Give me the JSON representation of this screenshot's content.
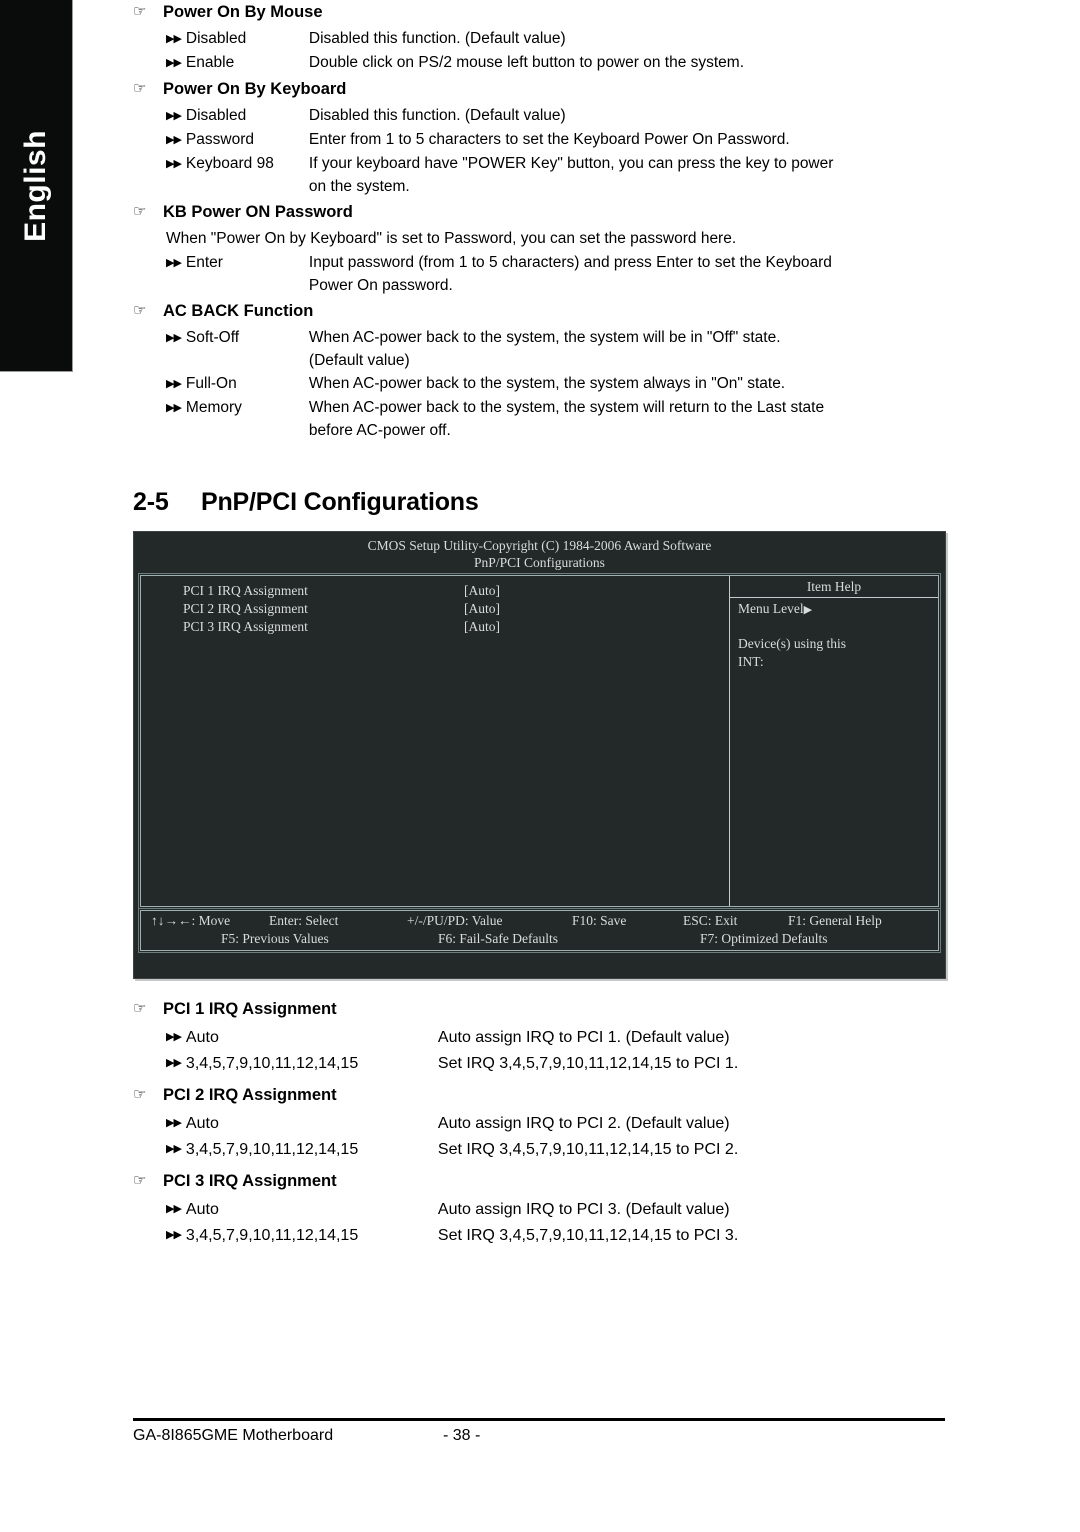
{
  "language_tab": {
    "label": "English"
  },
  "options_top": [
    {
      "icon": "hand-pointer-icon",
      "title": "Power On By Mouse",
      "rows": [
        {
          "name": "Disabled",
          "desc": "Disabled this function. (Default value)"
        },
        {
          "name": "Enable",
          "desc": "Double click on PS/2 mouse left button to power on the system."
        }
      ]
    },
    {
      "icon": "hand-pointer-icon",
      "title": "Power On By Keyboard",
      "rows": [
        {
          "name": "Disabled",
          "desc": "Disabled this function. (Default value)"
        },
        {
          "name": "Password",
          "desc": "Enter from 1 to 5 characters to set the Keyboard Power On Password."
        },
        {
          "name": "Keyboard 98",
          "desc": "If your keyboard have \"POWER Key\" button, you can press the key to power",
          "cont": "on the system."
        }
      ]
    },
    {
      "icon": "hand-pointer-icon",
      "title": "KB Power ON Password",
      "note": "When \"Power On by Keyboard\" is set to Password, you can set the password here.",
      "rows": [
        {
          "name": "Enter",
          "desc": "Input password (from 1 to 5 characters) and press Enter to set the Keyboard",
          "cont": "Power On password."
        }
      ]
    },
    {
      "icon": "hand-pointer-icon",
      "title": "AC BACK Function",
      "rows": [
        {
          "name": "Soft-Off",
          "desc": "When AC-power back to the system, the system will be in \"Off\" state.",
          "cont": "(Default value)"
        },
        {
          "name": "Full-On",
          "desc": "When AC-power back to the system, the system always in \"On\" state."
        },
        {
          "name": "Memory",
          "desc": "When AC-power back to the system, the system will return to the Last state",
          "cont": "before AC-power off."
        }
      ]
    }
  ],
  "section": {
    "number": "2-5",
    "title": "PnP/PCI Configurations"
  },
  "bios": {
    "title_line1": "CMOS Setup Utility-Copyright (C) 1984-2006 Award Software",
    "title_line2": "PnP/PCI Configurations",
    "items": [
      {
        "label": "PCI 1 IRQ Assignment",
        "value": "[Auto]"
      },
      {
        "label": "PCI 2 IRQ Assignment",
        "value": "[Auto]"
      },
      {
        "label": "PCI 3 IRQ Assignment",
        "value": "[Auto]"
      }
    ],
    "help": {
      "header": "Item Help",
      "menu_level": "Menu Level",
      "menu_level_arrow": "▶",
      "line1": "Device(s) using this",
      "line2": "INT:"
    },
    "footer": {
      "line1": [
        "↑↓→←: Move",
        "Enter: Select",
        "+/-/PU/PD: Value",
        "F10: Save",
        "ESC: Exit",
        "F1: General Help"
      ],
      "line2": [
        "F5: Previous Values",
        "F6: Fail-Safe Defaults",
        "F7: Optimized Defaults"
      ]
    },
    "colors": {
      "background": "#232829",
      "text": "#d8dcdc",
      "border": "#9fb0b0"
    }
  },
  "options_bottom": [
    {
      "icon": "hand-pointer-icon",
      "title": "PCI 1 IRQ Assignment",
      "rows": [
        {
          "name": "Auto",
          "desc": "Auto assign IRQ to PCI 1. (Default value)"
        },
        {
          "name": "3,4,5,7,9,10,11,12,14,15",
          "desc": "Set IRQ 3,4,5,7,9,10,11,12,14,15 to PCI 1."
        }
      ]
    },
    {
      "icon": "hand-pointer-icon",
      "title": "PCI 2 IRQ Assignment",
      "rows": [
        {
          "name": "Auto",
          "desc": "Auto assign IRQ to PCI 2. (Default value)"
        },
        {
          "name": "3,4,5,7,9,10,11,12,14,15",
          "desc": "Set IRQ 3,4,5,7,9,10,11,12,14,15 to PCI 2."
        }
      ]
    },
    {
      "icon": "hand-pointer-icon",
      "title": "PCI 3 IRQ Assignment",
      "rows": [
        {
          "name": "Auto",
          "desc": "Auto assign IRQ to PCI 3. (Default value)"
        },
        {
          "name": "3,4,5,7,9,10,11,12,14,15",
          "desc": "Set IRQ 3,4,5,7,9,10,11,12,14,15 to PCI 3."
        }
      ]
    }
  ],
  "page_footer": {
    "product": "GA-8I865GME Motherboard",
    "page_number": "- 38 -"
  },
  "glyphs": {
    "hand": "☞",
    "arrows": "▶▶"
  }
}
